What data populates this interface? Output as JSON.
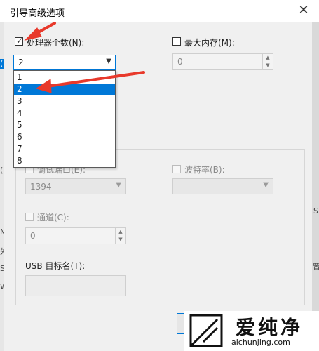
{
  "dialog": {
    "title": "引导高级选项",
    "close_glyph": "✕"
  },
  "processors": {
    "label": "处理器个数(N):",
    "checked": true,
    "selected_value": "2",
    "options": [
      "1",
      "2",
      "3",
      "4",
      "5",
      "6",
      "7",
      "8"
    ],
    "highlighted_option": "2"
  },
  "max_memory": {
    "label": "最大内存(M):",
    "checked": false,
    "value": "0"
  },
  "debug": {
    "debug_port_label": "调试端口(E):",
    "debug_port_value": "1394",
    "baud_rate_label": "波特率(B):",
    "baud_rate_value": "",
    "channel_label": "通道(C):",
    "channel_value": "0",
    "usb_target_label": "USB 目标名(T):",
    "usb_target_value": ""
  },
  "side_fragments": [
    "('",
    "(",
    "M",
    "外",
    "S",
    "W",
    "S",
    "置"
  ],
  "watermark": {
    "brand": "爱纯净",
    "url": "aichunjing.com"
  },
  "icons": {
    "close": "close-icon",
    "dropdown_arrow": "chevron-down-icon",
    "spin_up": "chevron-up-icon",
    "spin_down": "chevron-down-icon",
    "check": "checkmark-icon"
  },
  "colors": {
    "accent": "#0078d7",
    "annotation_arrow": "#e8392b"
  }
}
